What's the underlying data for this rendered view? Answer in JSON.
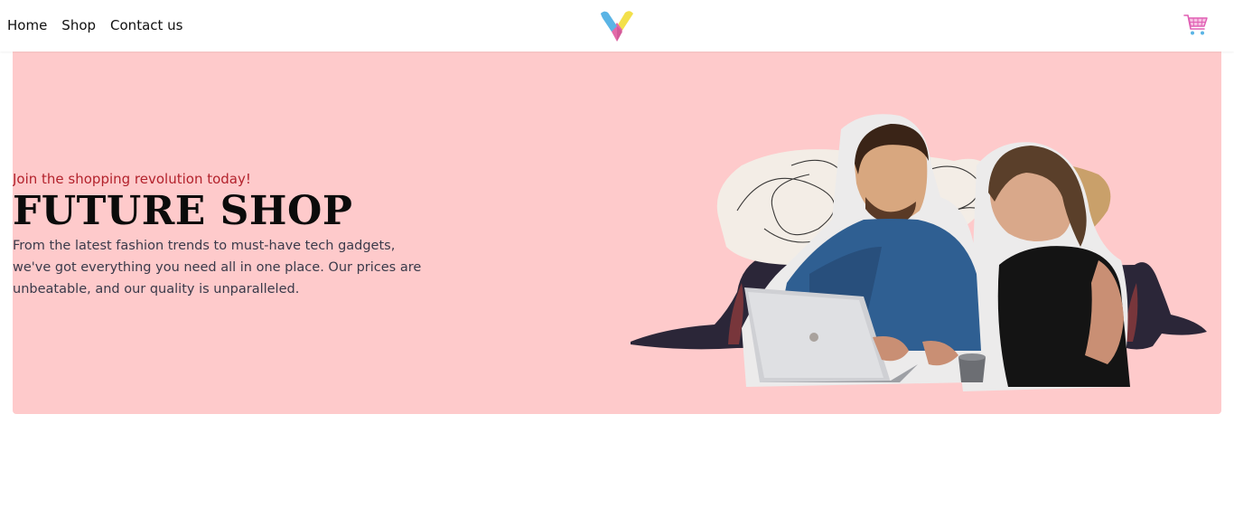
{
  "nav": {
    "links": [
      {
        "label": "Home"
      },
      {
        "label": "Shop"
      },
      {
        "label": "Contact us"
      }
    ],
    "logo_icon": "v-heart-logo-icon",
    "cart_icon": "shopping-cart-icon"
  },
  "hero": {
    "tagline": "Join the shopping revolution today!",
    "title": "FUTURE SHOP",
    "description": "From the latest fashion trends to must-have tech gadgets, we've got everything you need all in one place. Our prices are unbeatable, and our quality is unparalleled.",
    "image_icon": "people-with-laptop-illustration"
  },
  "colors": {
    "hero_background": "#fecacb",
    "tagline": "#b3222c",
    "title": "#0b0b0b",
    "logo_blue": "#5ab4e5",
    "logo_yellow": "#f3e04a",
    "logo_pink": "#e26aa8",
    "cart_pink": "#e05fb4"
  }
}
